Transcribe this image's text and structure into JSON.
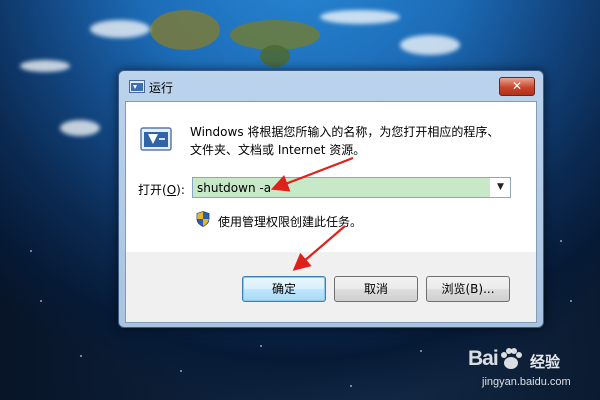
{
  "dialog": {
    "title": "运行",
    "close_glyph": "✕",
    "description_line1": "Windows 将根据您所输入的名称，为您打开相应的程序、",
    "description_line2": "文件夹、文档或 Internet 资源。",
    "open_label_prefix": "打开(",
    "open_label_key": "O",
    "open_label_suffix": "):",
    "command_value": "shutdown -a",
    "dropdown_glyph": "▼",
    "admin_note": "使用管理权限创建此任务。",
    "buttons": {
      "ok": "确定",
      "cancel": "取消",
      "browse": "浏览(B)..."
    }
  },
  "icons": {
    "title": "run-app-icon",
    "run": "run-app-icon",
    "shield": "uac-shield-icon",
    "dropdown": "chevron-down-icon"
  },
  "annotations": {
    "arrow_color": "#e0201a"
  },
  "watermark": {
    "logo_text": "Bai",
    "logo_suffix": "经验",
    "url": "jingyan.baidu.com"
  }
}
